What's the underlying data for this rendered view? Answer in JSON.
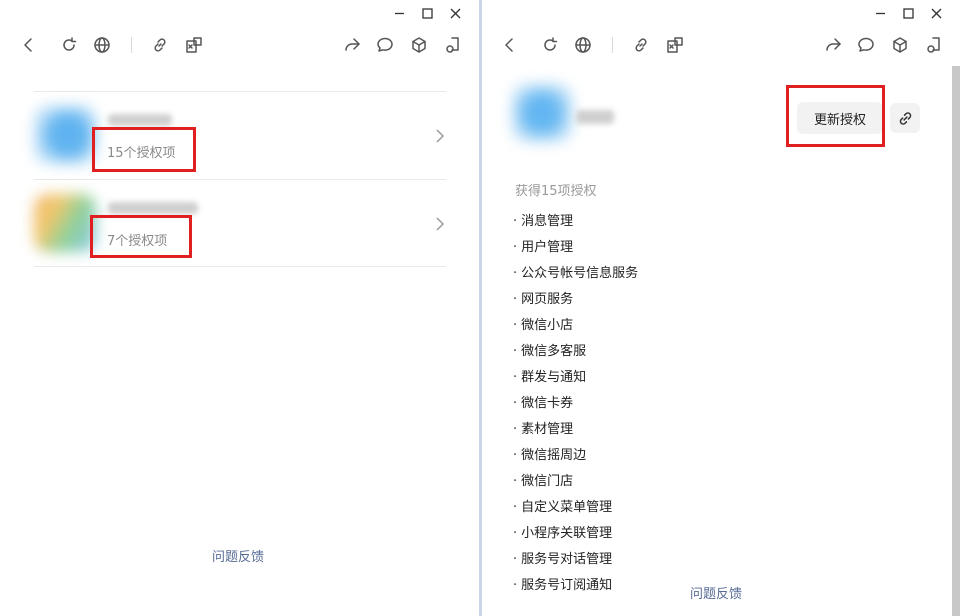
{
  "left_window": {
    "controls": {
      "minimize": "minimize",
      "maximize": "maximize",
      "close": "close"
    },
    "apps": [
      {
        "name": "",
        "count_label": "15个授权项"
      },
      {
        "name": "",
        "count_label": "7个授权项"
      }
    ],
    "feedback_link": "问题反馈"
  },
  "right_window": {
    "update_button": "更新授权",
    "grant_summary": "获得15项授权",
    "permissions": [
      "消息管理",
      "用户管理",
      "公众号帐号信息服务",
      "网页服务",
      "微信小店",
      "微信多客服",
      "群发与通知",
      "微信卡券",
      "素材管理",
      "微信摇周边",
      "微信门店",
      "自定义菜单管理",
      "小程序关联管理",
      "服务号对话管理",
      "服务号订阅通知"
    ],
    "bullet": "·",
    "feedback_link": "问题反馈"
  },
  "colors": {
    "highlight": "#e02020",
    "link": "#576b95",
    "divider": "#c9d6ea"
  }
}
